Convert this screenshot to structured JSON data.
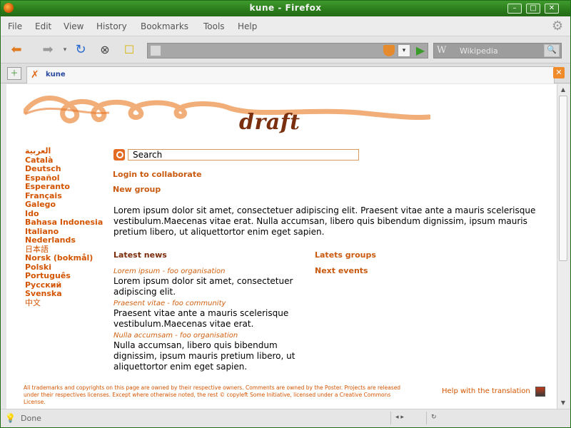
{
  "window": {
    "title": "kune - Firefox"
  },
  "menubar": {
    "items": [
      "File",
      "Edit",
      "View",
      "History",
      "Bookmarks",
      "Tools",
      "Help"
    ]
  },
  "searchbar": {
    "placeholder": "Wikipedia",
    "engine_glyph": "W"
  },
  "tab": {
    "label": "kune"
  },
  "page": {
    "logo_text": "draft",
    "languages": [
      "العربية",
      "Català",
      "Deutsch",
      "Español",
      "Esperanto",
      "Français",
      "Galego",
      "Ido",
      "Bahasa Indonesia",
      "Italiano",
      "Nederlands",
      "日本語",
      "Norsk (bokmål)",
      "Polski",
      "Português",
      "Русский",
      "Svenska",
      "中文"
    ],
    "search_value": "Search",
    "login_link": "Login to collaborate",
    "new_group_link": "New group",
    "intro": "Lorem ipsum dolor sit amet, consectetuer adipiscing elit. Praesent vitae ante a mauris scelerisque vestibulum.Maecenas vitae erat. Nulla accumsan, libero quis bibendum dignissim, ipsum mauris pretium libero, ut aliquettortor enim eget sapien.",
    "latest_news_title": "Latest news",
    "news": [
      {
        "meta": "Lorem ipsum - foo organisation",
        "body": "Lorem ipsum dolor sit amet, consectetuer adipiscing elit."
      },
      {
        "meta": "Praesent vitae - foo community",
        "body": "Praesent vitae ante a mauris scelerisque vestibulum.Maecenas vitae erat."
      },
      {
        "meta": "Nulla accumsam - foo organisation",
        "body": "Nulla accumsan, libero quis bibendum dignissim, ipsum mauris pretium libero, ut aliquettortor enim eget sapien."
      }
    ],
    "latest_groups_title": "Latets groups",
    "next_events_title": "Next events",
    "footer": "All trademarks and copyrights on this page are owned by their respective owners. Comments are owned by the Poster. Projects are released under their respectives licenses. Except where otherwise noted, the rest © copyleft Some Initiative, licensed under a Creative Commons License.",
    "help_translation": "Help with the translation"
  },
  "statusbar": {
    "status": "Done"
  },
  "colors": {
    "accent": "#d35400",
    "title_green": "#2a7b1b",
    "logo_brown": "#7a2f0f"
  }
}
